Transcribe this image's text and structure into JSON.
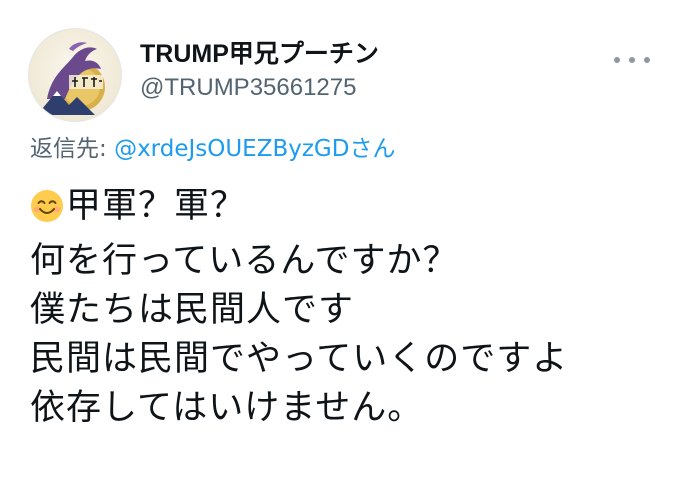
{
  "author": {
    "display_name": "TRUMP甲兄プーチン",
    "handle": "@TRUMP35661275"
  },
  "menu": {
    "icon": "more-horizontal-icon"
  },
  "reply": {
    "prefix": "返信先: ",
    "mention": "@xrdeJsOUEZByzGDさん"
  },
  "tweet": {
    "lines": [
      "甲軍？軍？",
      "何を行っているんですか？",
      "僕たちは民間人です",
      "民間は民間でやっていくのですよ",
      "依存してはいけません。"
    ],
    "emoji": "smiling-face-icon"
  },
  "colors": {
    "text": "#0f1419",
    "secondary": "#536471",
    "link": "#1d9bf0"
  }
}
